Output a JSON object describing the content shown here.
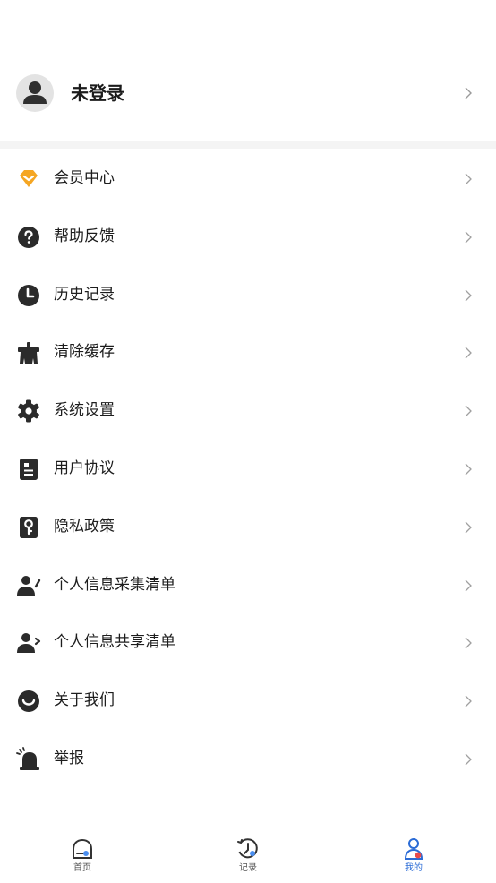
{
  "profile": {
    "name": "未登录",
    "avatar_icon": "user-avatar-icon"
  },
  "menu": [
    {
      "label": "会员中心",
      "icon": "diamond-icon",
      "color": "#f5a623"
    },
    {
      "label": "帮助反馈",
      "icon": "question-icon",
      "color": "#2b2b2b"
    },
    {
      "label": "历史记录",
      "icon": "clock-icon",
      "color": "#2b2b2b"
    },
    {
      "label": "清除缓存",
      "icon": "broom-icon",
      "color": "#2b2b2b"
    },
    {
      "label": "系统设置",
      "icon": "gear-icon",
      "color": "#2b2b2b"
    },
    {
      "label": "用户协议",
      "icon": "document-icon",
      "color": "#2b2b2b"
    },
    {
      "label": "隐私政策",
      "icon": "privacy-key-icon",
      "color": "#2b2b2b"
    },
    {
      "label": "个人信息采集清单",
      "icon": "user-edit-icon",
      "color": "#2b2b2b"
    },
    {
      "label": "个人信息共享清单",
      "icon": "user-share-icon",
      "color": "#2b2b2b"
    },
    {
      "label": "关于我们",
      "icon": "smile-icon",
      "color": "#2b2b2b"
    },
    {
      "label": "举报",
      "icon": "alarm-icon",
      "color": "#2b2b2b"
    }
  ],
  "tabbar": {
    "tabs": [
      {
        "label": "首页",
        "icon": "home-icon",
        "active": false
      },
      {
        "label": "记录",
        "icon": "history-icon",
        "active": false
      },
      {
        "label": "我的",
        "icon": "profile-icon",
        "active": true
      }
    ],
    "active_color": "#2a6bd6",
    "accent_color": "#e84b4b"
  }
}
